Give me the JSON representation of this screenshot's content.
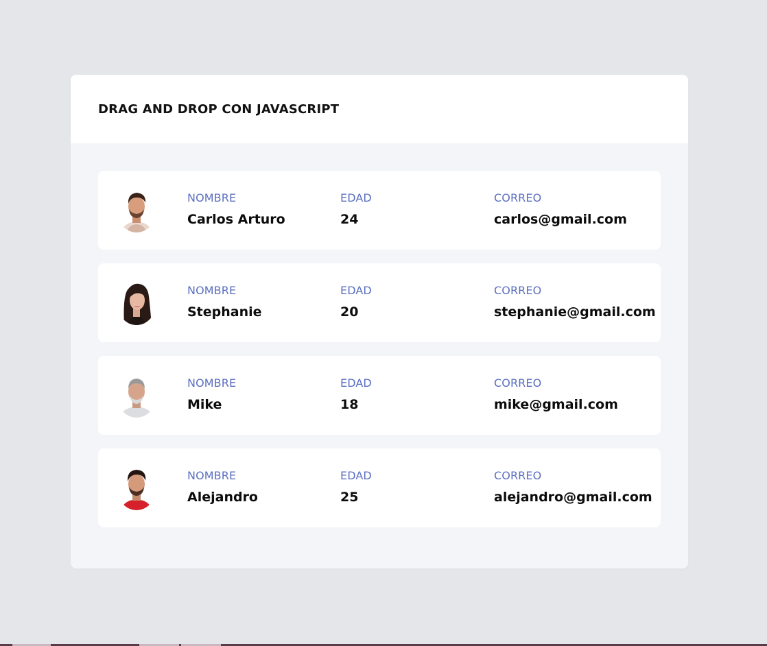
{
  "card": {
    "title": "DRAG AND DROP CON JAVASCRIPT"
  },
  "labels": {
    "name": "NOMBRE",
    "age": "EDAD",
    "email": "CORREO"
  },
  "people": [
    {
      "name": "Carlos Arturo",
      "age": "24",
      "email": "carlos@gmail.com",
      "avatar": "avatar-carlos"
    },
    {
      "name": "Stephanie",
      "age": "20",
      "email": "stephanie@gmail.com",
      "avatar": "avatar-stephanie"
    },
    {
      "name": "Mike",
      "age": "18",
      "email": "mike@gmail.com",
      "avatar": "avatar-mike"
    },
    {
      "name": "Alejandro",
      "age": "25",
      "email": "alejandro@gmail.com",
      "avatar": "avatar-alejandro"
    }
  ],
  "colors": {
    "background": "#e4e6ea",
    "card_body": "#f4f5f9",
    "label": "#5b6fbf",
    "value": "#0c0c0c"
  }
}
